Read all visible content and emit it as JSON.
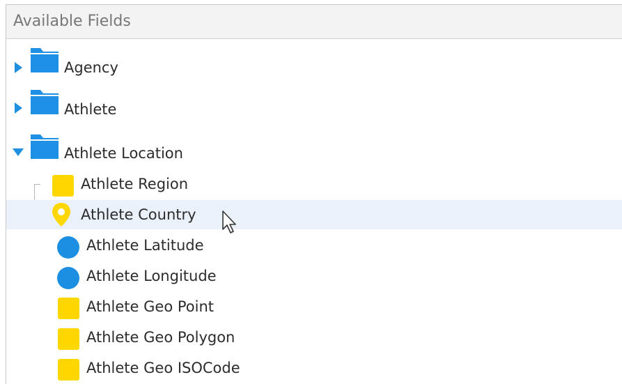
{
  "panel": {
    "title": "Available Fields"
  },
  "folders": [
    {
      "label": "Agency",
      "expanded": false
    },
    {
      "label": "Athlete",
      "expanded": false
    },
    {
      "label": "Athlete Location",
      "expanded": true
    }
  ],
  "fields": [
    {
      "label": "Athlete Region",
      "icon": "yellow-square-icon"
    },
    {
      "label": "Athlete Country",
      "icon": "map-pin-icon",
      "hovered": true
    },
    {
      "label": "Athlete Latitude",
      "icon": "blue-circle-icon"
    },
    {
      "label": "Athlete Longitude",
      "icon": "blue-circle-icon"
    },
    {
      "label": "Athlete Geo Point",
      "icon": "yellow-square-icon"
    },
    {
      "label": "Athlete Geo Polygon",
      "icon": "yellow-square-icon"
    },
    {
      "label": "Athlete Geo ISOCode",
      "icon": "yellow-square-icon"
    }
  ],
  "colors": {
    "accent_blue": "#1f8fe0",
    "dimension_yellow": "#ffd700",
    "measure_blue": "#1d8fe3",
    "hover_row": "#eaf1fa"
  }
}
